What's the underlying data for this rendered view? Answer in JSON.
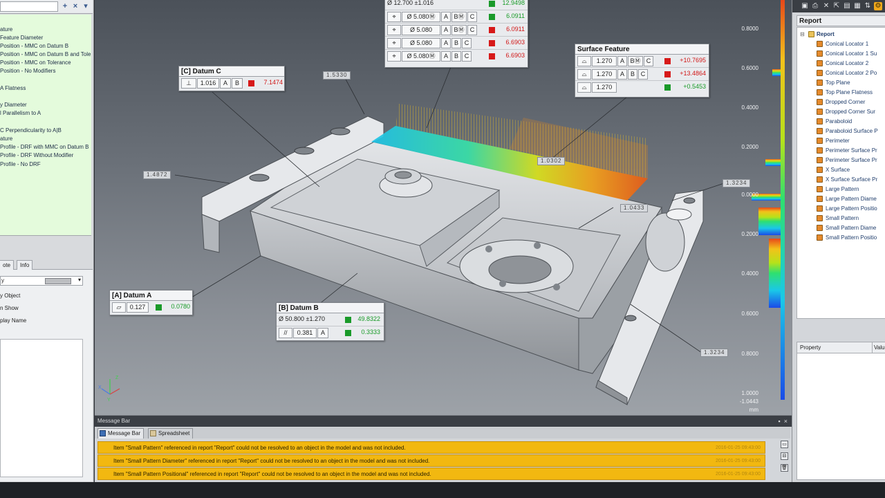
{
  "left_panel": {
    "features": [
      "ature",
      "Feature Diameter",
      "Position - MMC on Datum B",
      "Position - MMC on Datum B and Tole",
      "Position - MMC on Tolerance",
      "Position - No Modifiers",
      "A Flatness",
      "y Diameter",
      "l Parallelism to A",
      "C Perpendicularity to A|B",
      "ature",
      "Profile - DRF with MMC on Datum B",
      "Profile - DRF Without Modifier",
      "Profile - No DRF"
    ],
    "tabs": [
      "ote",
      "Info"
    ],
    "prop_rows": [
      "y",
      "y Object",
      "n Show",
      "play Name"
    ]
  },
  "viewport": {
    "datum_c": {
      "title": "[C] Datum C",
      "symbol": "⊥",
      "tol": "1.016",
      "refs": [
        "A",
        "B"
      ],
      "value": "7.1474"
    },
    "datum_a": {
      "title": "[A] Datum A",
      "symbol": "⏥",
      "tol": "0.127",
      "value": "0.0780"
    },
    "datum_b": {
      "title": "[B] Datum B",
      "dim": "Ø 50.800 ±1.270",
      "dim_value": "49.8322",
      "par_symbol": "//",
      "par_tol": "0.381",
      "par_ref": "A",
      "par_value": "0.3333"
    },
    "position": {
      "dim": "Ø  12.700 ±1.016",
      "dim_value": "12.9498",
      "rows": [
        {
          "tol": "Ø 5.080Ⓜ",
          "refs": [
            "A",
            "BⓂ",
            "C"
          ],
          "value": "6.0911",
          "status": "g"
        },
        {
          "tol": "Ø 5.080",
          "refs": [
            "A",
            "BⓂ",
            "C"
          ],
          "value": "6.0911",
          "status": "r"
        },
        {
          "tol": "Ø 5.080",
          "refs": [
            "A",
            "B",
            "C"
          ],
          "value": "6.6903",
          "status": "r"
        },
        {
          "tol": "Ø 5.080Ⓜ",
          "refs": [
            "A",
            "B",
            "C"
          ],
          "value": "6.6903",
          "status": "r"
        }
      ]
    },
    "surface_feature": {
      "title": "Surface Feature",
      "rows": [
        {
          "tol": "1.270",
          "refs": [
            "A",
            "BⓂ",
            "C"
          ],
          "value": "+10.7695",
          "status": "r"
        },
        {
          "tol": "1.270",
          "refs": [
            "A",
            "B",
            "C"
          ],
          "value": "+13.4864",
          "status": "r"
        },
        {
          "tol": "1.270",
          "refs": [],
          "value": "+0.5453",
          "status": "g"
        }
      ]
    },
    "tags": [
      "1.5330",
      "1.4872",
      "1.0302",
      "1.0433",
      "1.3234",
      "1.3234"
    ],
    "scale": [
      "0.8000",
      "0.6000",
      "0.4000",
      "0.2000",
      "0.0000",
      "0.2000",
      "0.4000",
      "0.6000",
      "0.8000",
      "1.0000",
      "-1.0443",
      "mm"
    ],
    "axes": {
      "x": "X",
      "y": "Y",
      "z": "Z"
    }
  },
  "message_bar": {
    "title": "Message Bar",
    "tabs": [
      "Message Bar",
      "Spreadsheet"
    ],
    "messages": [
      {
        "text": "Item \"Small Pattern\" referenced in report \"Report\" could not be resolved to an object in the model and was not included.",
        "time": "2016-01-25 09:43:00"
      },
      {
        "text": "Item \"Small Pattern Diameter\" referenced in report \"Report\" could not be resolved to an object in the model and was not included.",
        "time": "2016-01-25 09:43:00"
      },
      {
        "text": "Item \"Small Pattern Positional\" referenced in report \"Report\" could not be resolved to an object in the model and was not included.",
        "time": "2016-01-25 09:43:00"
      }
    ]
  },
  "right_panel": {
    "title": "Report",
    "root": "Report",
    "items": [
      "Conical Locator 1",
      "Conical Locator 1 Su",
      "Conical Locator 2",
      "Conical Locator 2 Po",
      "Top Plane",
      "Top Plane Flatness",
      "Dropped Corner",
      "Dropped Corner Sur",
      "Paraboloid",
      "Paraboloid Surface P",
      "Perimeter",
      "Perimeter Surface Pr",
      "Perimeter Surface Pr",
      "X Surface",
      "X Surface Surface Pr",
      "Large Pattern",
      "Large Pattern Diame",
      "Large Pattern Positio",
      "Small Pattern",
      "Small Pattern Diame",
      "Small Pattern Positio"
    ],
    "prop_header": "Property",
    "value_header": "Valu"
  },
  "colors": {
    "pass": "#1a9a2a",
    "fail": "#d71919",
    "warning": "#f2b810",
    "feature_list_bg": "#e4fbdc"
  }
}
